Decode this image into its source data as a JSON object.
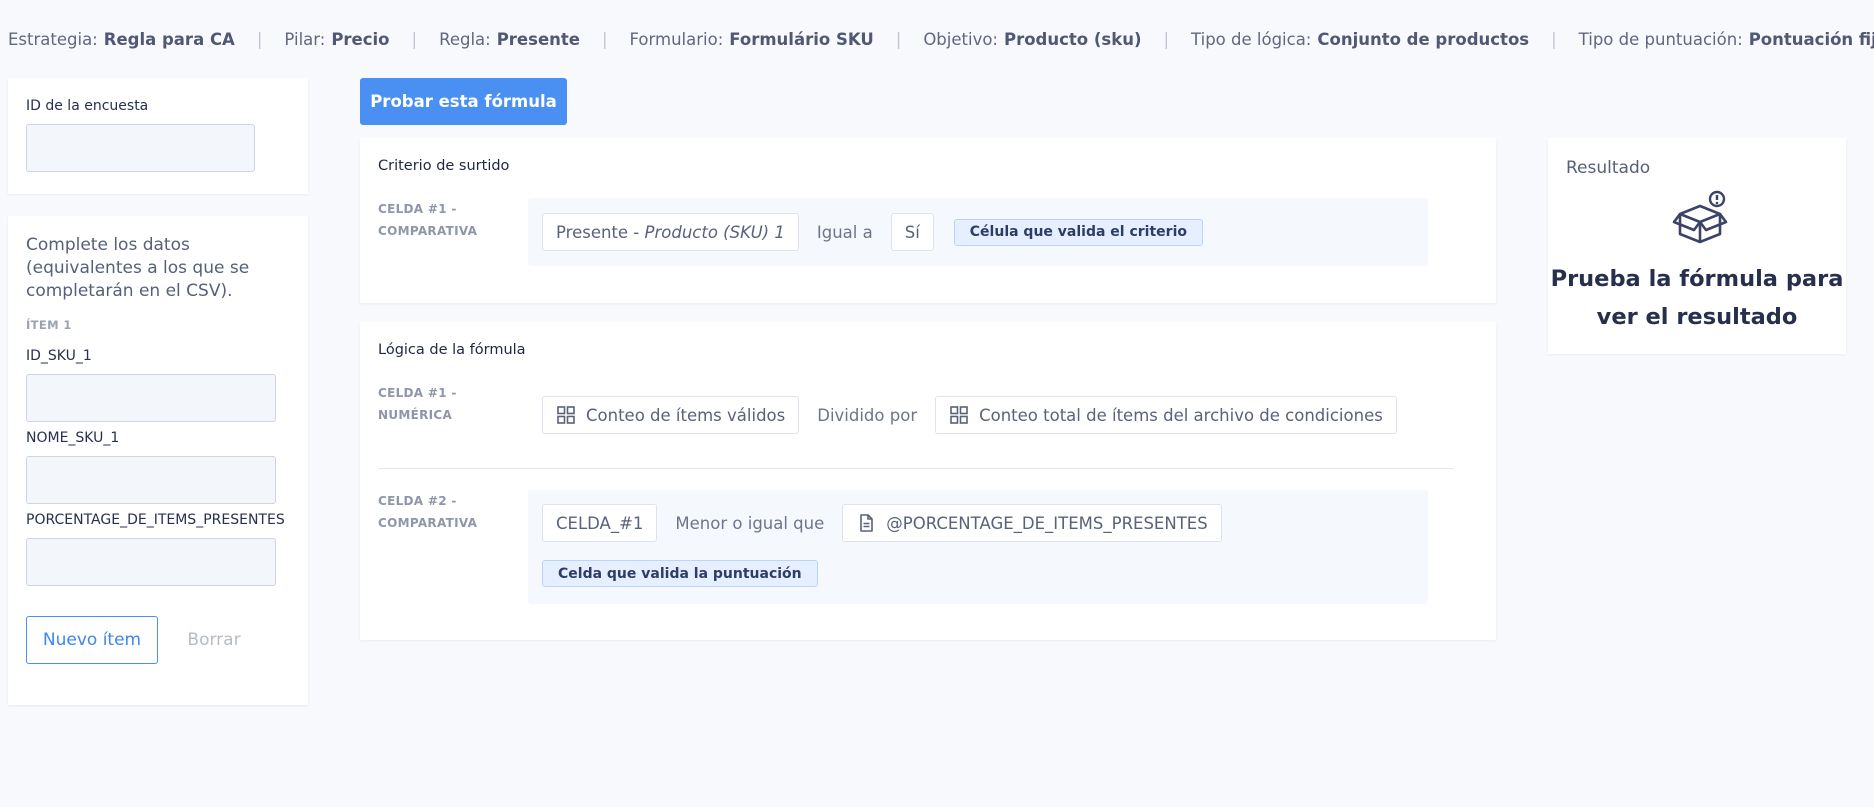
{
  "breadcrumb": [
    {
      "label": "Estrategia:",
      "value": "Regla para CA"
    },
    {
      "label": "Pilar:",
      "value": "Precio"
    },
    {
      "label": "Regla:",
      "value": "Presente"
    },
    {
      "label": "Formulario:",
      "value": "Formulário SKU"
    },
    {
      "label": "Objetivo:",
      "value": "Producto (sku)"
    },
    {
      "label": "Tipo de lógica:",
      "value": "Conjunto de productos"
    },
    {
      "label": "Tipo de puntuación:",
      "value": "Pontuación fija"
    }
  ],
  "breadcrumb_separator": "|",
  "survey": {
    "label": "ID de la encuesta",
    "value": ""
  },
  "data_panel": {
    "intro": "Complete los datos (equivalentes a los que se completarán en el CSV).",
    "item_heading": "ÍTEM 1",
    "fields": [
      {
        "label": "ID_SKU_1",
        "value": ""
      },
      {
        "label": "NOME_SKU_1",
        "value": ""
      },
      {
        "label": "PORCENTAGE_DE_ITEMS_PRESENTES",
        "value": ""
      }
    ],
    "new_item_label": "Nuevo ítem",
    "clear_label": "Borrar"
  },
  "test_button_label": "Probar esta fórmula",
  "criteria": {
    "title": "Criterio de surtido",
    "cell1": {
      "label_line1": "CELDA #1 -",
      "label_line2": "COMPARATIVA",
      "operand_prefix": "Presente - ",
      "operand_italic": "Producto (SKU) 1",
      "operator": "Igual a",
      "value": "Sí",
      "tag": "Célula que valida el criterio"
    }
  },
  "logic": {
    "title": "Lógica de la fórmula",
    "cell1": {
      "label_line1": "CELDA #1 -",
      "label_line2": "NUMÉRICA",
      "left": "Conteo de ítems válidos",
      "left_icon": "grid-icon",
      "operator": "Dividido por",
      "right": "Conteo total de ítems del archivo de condiciones",
      "right_icon": "grid-icon"
    },
    "cell2": {
      "label_line1": "CELDA #2 -",
      "label_line2": "COMPARATIVA",
      "left": "CELDA_#1",
      "operator": "Menor o igual que",
      "right": "@PORCENTAGE_DE_ITEMS_PRESENTES",
      "right_icon": "document-icon",
      "tag": "Celda que valida la puntuación"
    }
  },
  "result": {
    "title": "Resultado",
    "icon": "box-alert-icon",
    "message": "Prueba la fórmula para ver el resultado"
  },
  "colors": {
    "accent": "#4a90f3",
    "tag_bg": "#e5efff",
    "text_dark": "#26304d"
  }
}
